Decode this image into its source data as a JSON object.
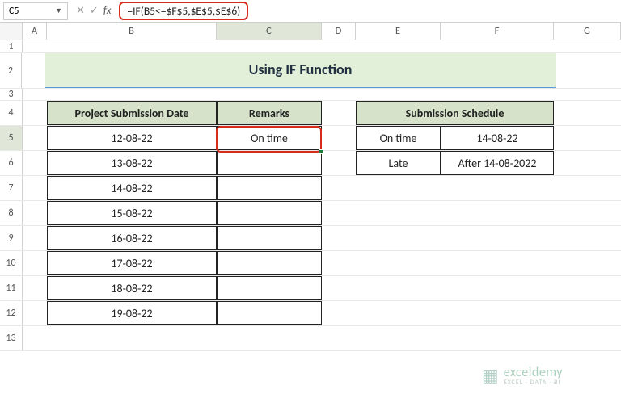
{
  "name_box": "C5",
  "formula": "=IF(B5<=$F$5,$E$5,$E$6)",
  "columns": [
    "A",
    "B",
    "C",
    "D",
    "E",
    "F",
    "G"
  ],
  "row_numbers": [
    "1",
    "2",
    "3",
    "4",
    "5",
    "6",
    "7",
    "8",
    "9",
    "10",
    "11",
    "12",
    "13"
  ],
  "title": "Using IF Function",
  "left_table": {
    "headers": [
      "Project Submission Date",
      "Remarks"
    ],
    "rows": [
      {
        "date": "12-08-22",
        "remark": "On time"
      },
      {
        "date": "13-08-22",
        "remark": ""
      },
      {
        "date": "14-08-22",
        "remark": ""
      },
      {
        "date": "15-08-22",
        "remark": ""
      },
      {
        "date": "16-08-22",
        "remark": ""
      },
      {
        "date": "17-08-22",
        "remark": ""
      },
      {
        "date": "18-08-22",
        "remark": ""
      },
      {
        "date": "19-08-22",
        "remark": ""
      }
    ]
  },
  "right_table": {
    "header": "Submission Schedule",
    "rows": [
      {
        "status": "On time",
        "rule": "14-08-22"
      },
      {
        "status": "Late",
        "rule": "After 14-08-2022"
      }
    ]
  },
  "watermark": {
    "main": "exceldemy",
    "sub": "EXCEL · DATA · BI"
  }
}
